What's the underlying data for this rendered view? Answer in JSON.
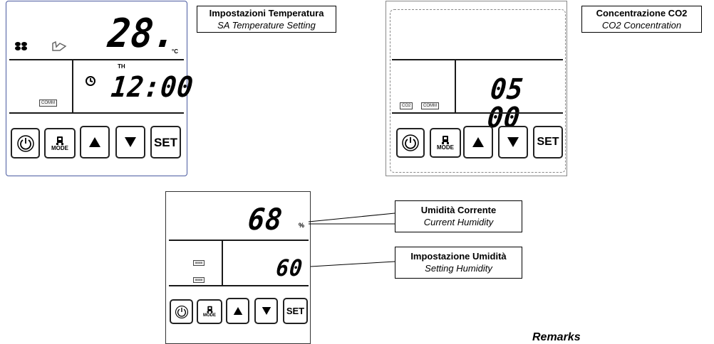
{
  "panel_temperature": {
    "display_value": "28.",
    "unit": "°C",
    "indicator": "TH",
    "time": "12:00",
    "tag_comm": "COMM",
    "label_title": "Impostazioni Temperatura",
    "label_subtitle": "SA Temperature Setting"
  },
  "panel_co2": {
    "display_value": "05 00",
    "tag_co2": "CO2",
    "tag_comm": "COMM",
    "label_title": "Concentrazione CO2",
    "label_subtitle": "CO2 Concentration"
  },
  "panel_humidity": {
    "display_value": "68",
    "unit": "%",
    "setting_value": "60",
    "tag_1": "IIIIIIIII",
    "tag_2": "IIIIIIIII",
    "label_current_title": "Umidità Corrente",
    "label_current_subtitle": "Current  Humidity",
    "label_setting_title": "Impostazione Umidità",
    "label_setting_subtitle": "Setting Humidity"
  },
  "buttons": {
    "mode_label": "MODE",
    "set_label": "SET"
  },
  "remarks": "Remarks"
}
